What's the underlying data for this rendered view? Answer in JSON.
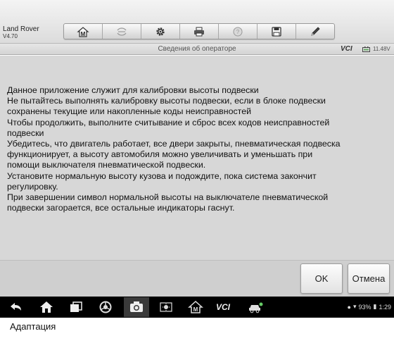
{
  "header": {
    "app_title": "Land Rover",
    "version": "V4.70",
    "toolbar": [
      {
        "name": "home-icon",
        "label": "M"
      },
      {
        "name": "vehicle-swap-icon"
      },
      {
        "name": "settings-icon"
      },
      {
        "name": "print-icon"
      },
      {
        "name": "help-icon"
      },
      {
        "name": "save-icon"
      },
      {
        "name": "edit-icon"
      }
    ]
  },
  "status": {
    "title": "Сведения об операторе",
    "vci": "VCI",
    "voltage": "11.48V"
  },
  "message": {
    "lines": [
      "Данное приложение служит для калибровки высоты подвески",
      "Не пытайтесь выполнять калибровку высоты подвески, если в блоке подвески",
      "сохранены текущие или накопленные коды неисправностей",
      "Чтобы продолжить, выполните считывание и сброс всех кодов неисправностей",
      "подвески",
      "Убедитесь, что двигатель работает, все двери закрыты, пневматическая подвеска",
      "функционирует, а высоту автомобиля можно увеличивать и уменьшать при",
      "помощи выключателя пневматической подвески.",
      "Установите нормальную высоту кузова и подождите, пока система закончит",
      "регулировку.",
      "При завершении символ нормальной высоты на выключателе пневматической",
      "подвески загорается, все остальные индикаторы гаснут."
    ]
  },
  "buttons": {
    "ok": "OK",
    "cancel": "Отмена"
  },
  "navbar": {
    "vci": "VCI",
    "battery_percent": "93%",
    "time": "1:29"
  },
  "caption": "Адаптация"
}
